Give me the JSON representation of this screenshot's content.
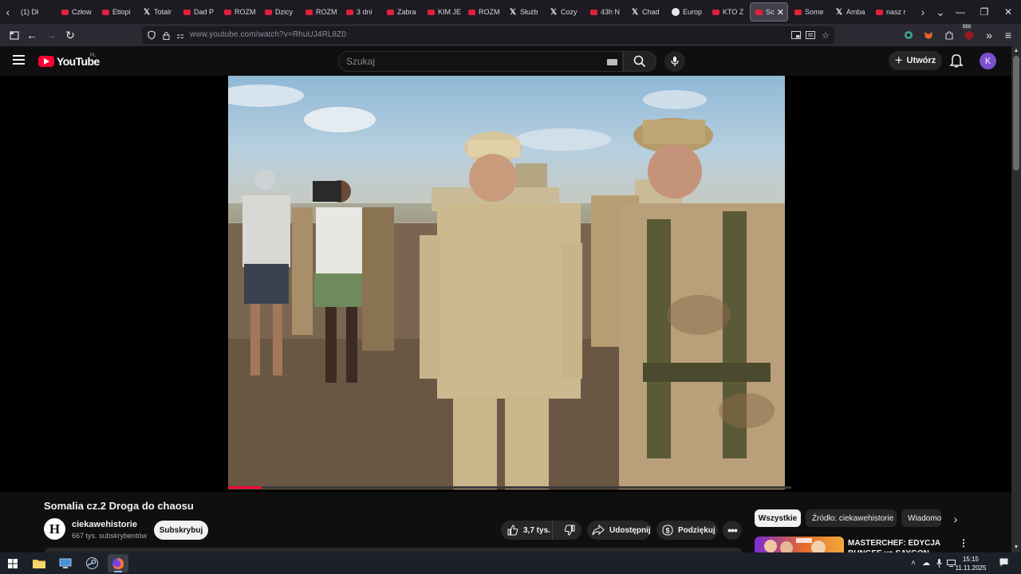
{
  "browser": {
    "tabs": [
      {
        "label": "(1) Dł",
        "icon": "none"
      },
      {
        "label": "Człow",
        "icon": "youtube-icon"
      },
      {
        "label": "Etiopi",
        "icon": "youtube-icon"
      },
      {
        "label": "Totalr",
        "icon": "x-icon"
      },
      {
        "label": "Dad P",
        "icon": "youtube-icon"
      },
      {
        "label": "ROZM",
        "icon": "youtube-icon"
      },
      {
        "label": "Dzicy",
        "icon": "youtube-icon"
      },
      {
        "label": "ROZM",
        "icon": "youtube-icon"
      },
      {
        "label": "3 dni",
        "icon": "youtube-icon"
      },
      {
        "label": "Zabra",
        "icon": "youtube-icon"
      },
      {
        "label": "KIM JE",
        "icon": "youtube-icon"
      },
      {
        "label": "ROZM",
        "icon": "youtube-icon"
      },
      {
        "label": "Służb",
        "icon": "x-icon"
      },
      {
        "label": "Cozy",
        "icon": "x-icon"
      },
      {
        "label": "43h N",
        "icon": "youtube-icon"
      },
      {
        "label": "Chad",
        "icon": "x-icon"
      },
      {
        "label": "Europ",
        "icon": "globe-icon"
      },
      {
        "label": "KTO Z",
        "icon": "youtube-icon"
      },
      {
        "label": "Son",
        "icon": "youtube-icon",
        "active": true
      },
      {
        "label": "Some",
        "icon": "youtube-icon"
      },
      {
        "label": "Amba",
        "icon": "x-icon"
      },
      {
        "label": "nasz r",
        "icon": "youtube-icon"
      }
    ],
    "url": "www.youtube.com/watch?v=RhuUJ4RL8Z0",
    "extension_badge": "550"
  },
  "youtube": {
    "logo_text": "YouTube",
    "country_code": "PL",
    "search_placeholder": "Szukaj",
    "create_label": "Utwórz",
    "avatar_letter": "K"
  },
  "video": {
    "title": "Somalia cz.2 Droga do chaosu",
    "progress_fraction": 0.06
  },
  "channel": {
    "avatar_letter": "H",
    "name": "ciekawehistorie",
    "subscribers": "667 tys. subskrybentów",
    "subscribe_label": "Subskrybuj"
  },
  "actions": {
    "likes": "3,7 tys.",
    "share_label": "Udostępnij",
    "thanks_label": "Podziękuj"
  },
  "chips": [
    "Wszystkie",
    "Źródło: ciekawehistorie",
    "Wiadomości"
  ],
  "recommendation": {
    "title": "MASTERCHEF: EDYCJA BUNGEE vs SAYGON"
  },
  "taskbar": {
    "time": "15:15",
    "date": "11.11.2025"
  },
  "colors": {
    "yt_red": "#ff0033",
    "background": "#0f0f0f",
    "avatar": "#7b4fcf"
  }
}
